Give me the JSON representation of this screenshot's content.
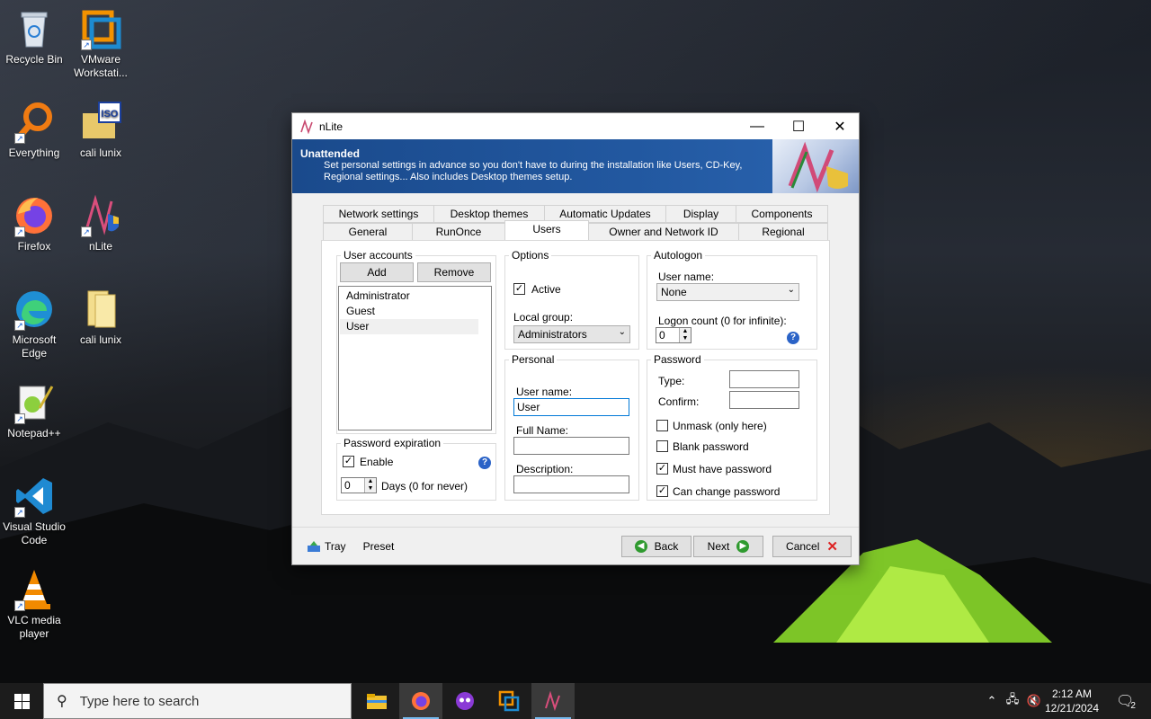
{
  "desktop": {
    "icons": [
      {
        "label": "Recycle Bin",
        "icon": "recycle-bin-icon"
      },
      {
        "label": "VMware Workstati...",
        "icon": "vmware-icon"
      },
      {
        "label": "Everything",
        "icon": "everything-search-icon"
      },
      {
        "label": "cali lunix",
        "icon": "iso-folder-icon"
      },
      {
        "label": "Firefox",
        "icon": "firefox-icon"
      },
      {
        "label": "nLite",
        "icon": "nlite-icon"
      },
      {
        "label": "Microsoft Edge",
        "icon": "edge-icon"
      },
      {
        "label": "cali lunix",
        "icon": "folder-icon"
      },
      {
        "label": "Notepad++",
        "icon": "notepadpp-icon"
      },
      {
        "label": "Visual Studio Code",
        "icon": "vscode-icon"
      },
      {
        "label": "VLC media player",
        "icon": "vlc-icon"
      }
    ]
  },
  "window": {
    "title": "nLite",
    "header_title": "Unattended",
    "header_desc": "Set personal settings in advance so you don't have to during the installation like Users, CD-Key, Regional settings... Also includes Desktop themes setup.",
    "tabs_row1": [
      "Network settings",
      "Desktop themes",
      "Automatic Updates",
      "Display",
      "Components"
    ],
    "tabs_row2": [
      "General",
      "RunOnce",
      "Users",
      "Owner and Network ID",
      "Regional"
    ],
    "active_tab": "Users"
  },
  "user_accounts": {
    "label": "User accounts",
    "add": "Add",
    "remove": "Remove",
    "items": [
      "Administrator",
      "Guest",
      "User"
    ],
    "selected": "User"
  },
  "password_expiration": {
    "label": "Password expiration",
    "enable_label": "Enable",
    "enable_checked": true,
    "days_value": "0",
    "days_label": "Days (0 for never)"
  },
  "options": {
    "label": "Options",
    "active_label": "Active",
    "active_checked": true,
    "local_group_label": "Local group:",
    "local_group_value": "Administrators"
  },
  "personal": {
    "label": "Personal",
    "username_label": "User name:",
    "username_value": "User",
    "fullname_label": "Full Name:",
    "fullname_value": "",
    "description_label": "Description:",
    "description_value": ""
  },
  "autologon": {
    "label": "Autologon",
    "username_label": "User name:",
    "username_value": "None",
    "logon_count_label": "Logon count (0 for infinite):",
    "logon_count_value": "0"
  },
  "password": {
    "label": "Password",
    "type_label": "Type:",
    "confirm_label": "Confirm:",
    "unmask_label": "Unmask (only here)",
    "unmask_checked": false,
    "blank_label": "Blank password",
    "blank_checked": false,
    "must_have_label": "Must have password",
    "must_have_checked": true,
    "can_change_label": "Can change password",
    "can_change_checked": true
  },
  "footer": {
    "tray": "Tray",
    "preset": "Preset",
    "back": "Back",
    "next": "Next",
    "cancel": "Cancel"
  },
  "taskbar": {
    "search_placeholder": "Type here to search",
    "time": "2:12 AM",
    "date": "12/21/2024",
    "notification_count": "2"
  },
  "colors": {
    "header_blue": "#1a4a8c",
    "accent": "#0078d7",
    "taskbar": "#1c1c1c"
  }
}
